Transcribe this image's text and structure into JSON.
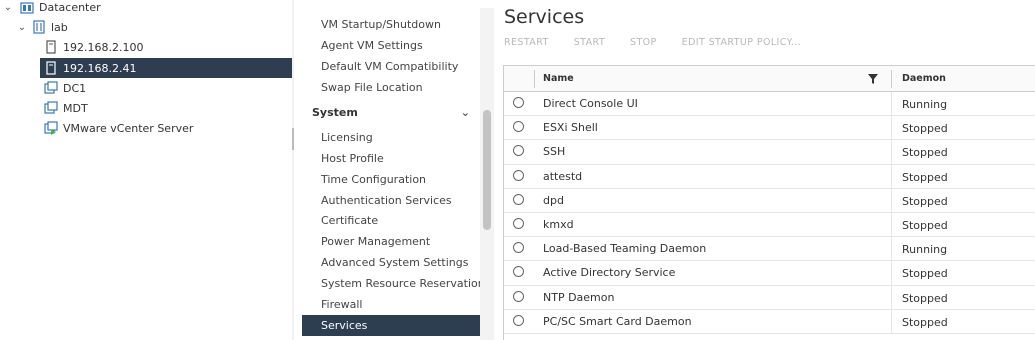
{
  "tree": {
    "items": [
      {
        "label": "Datacenter",
        "icon": "datacenter-icon",
        "expanded": true
      },
      {
        "label": "lab",
        "icon": "cluster-icon",
        "expanded": true
      },
      {
        "label": "192.168.2.100",
        "icon": "host-icon"
      },
      {
        "label": "192.168.2.41",
        "icon": "host-icon",
        "selected": true
      },
      {
        "label": "DC1",
        "icon": "vm-icon"
      },
      {
        "label": "MDT",
        "icon": "vm-icon"
      },
      {
        "label": "VMware vCenter Server",
        "icon": "vm-running-icon"
      }
    ]
  },
  "nav": {
    "items_top": [
      "VM Startup/Shutdown",
      "Agent VM Settings",
      "Default VM Compatibility",
      "Swap File Location"
    ],
    "section": "System",
    "items_system": [
      "Licensing",
      "Host Profile",
      "Time Configuration",
      "Authentication Services",
      "Certificate",
      "Power Management",
      "Advanced System Settings",
      "System Resource Reservation",
      "Firewall",
      "Services"
    ],
    "active": "Services"
  },
  "services": {
    "title": "Services",
    "toolbar": {
      "restart": "RESTART",
      "start": "START",
      "stop": "STOP",
      "edit_policy": "EDIT STARTUP POLICY..."
    },
    "columns": {
      "name": "Name",
      "daemon": "Daemon"
    },
    "rows": [
      {
        "name": "Direct Console UI",
        "daemon": "Running"
      },
      {
        "name": "ESXi Shell",
        "daemon": "Stopped"
      },
      {
        "name": "SSH",
        "daemon": "Stopped"
      },
      {
        "name": "attestd",
        "daemon": "Stopped"
      },
      {
        "name": "dpd",
        "daemon": "Stopped"
      },
      {
        "name": "kmxd",
        "daemon": "Stopped"
      },
      {
        "name": "Load-Based Teaming Daemon",
        "daemon": "Running"
      },
      {
        "name": "Active Directory Service",
        "daemon": "Stopped"
      },
      {
        "name": "NTP Daemon",
        "daemon": "Stopped"
      },
      {
        "name": "PC/SC Smart Card Daemon",
        "daemon": "Stopped"
      }
    ]
  },
  "colors": {
    "selected_bg": "#2c3e50",
    "accent_blue": "#3a79b8"
  }
}
